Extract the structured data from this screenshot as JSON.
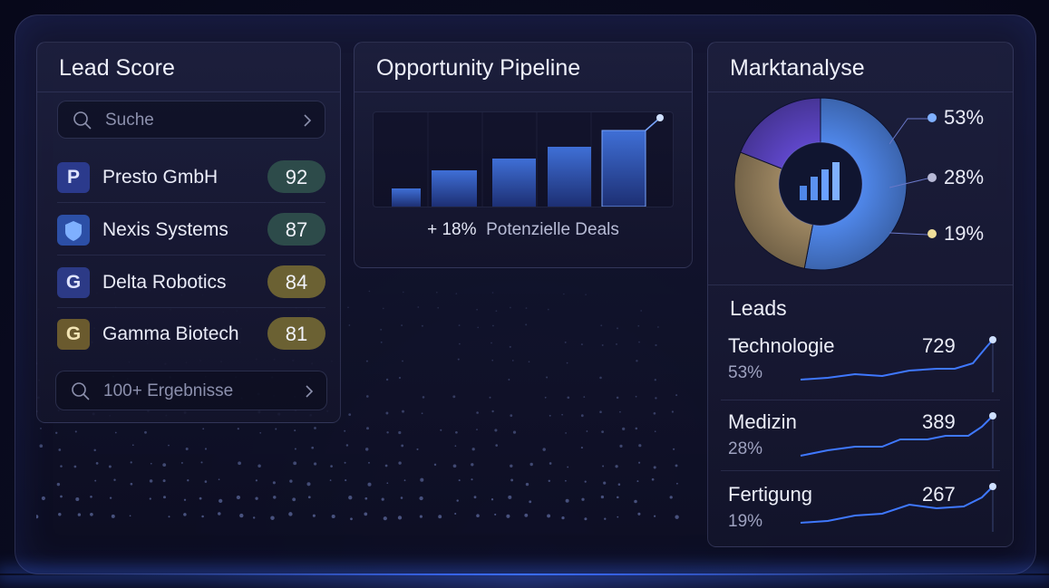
{
  "lead_score": {
    "title": "Lead Score",
    "search_placeholder": "Suche",
    "items": [
      {
        "logo": "P",
        "name": "Presto GmbH",
        "score": "92"
      },
      {
        "logo": "",
        "name": "Nexis Systems",
        "score": "87"
      },
      {
        "logo": "G",
        "name": "Delta Robotics",
        "score": "84"
      },
      {
        "logo": "G",
        "name": "Gamma Biotech",
        "score": "81"
      }
    ],
    "results_label": "100+ Ergebnisse"
  },
  "pipeline": {
    "title": "Opportunity Pipeline",
    "change": "+  18%",
    "caption": "Potenzielle Deals"
  },
  "market": {
    "title": "Marktanalyse",
    "pie": [
      {
        "label": "53%",
        "value": 53,
        "color": "#4f86e8"
      },
      {
        "label": "28%",
        "value": 28,
        "color": "#9a8460"
      },
      {
        "label": "19%",
        "value": 19,
        "color": "#5e46c8"
      }
    ],
    "leads_title": "Leads",
    "leads": [
      {
        "name": "Technologie",
        "percent": "53%",
        "value": "729"
      },
      {
        "name": "Medizin",
        "percent": "28%",
        "value": "389"
      },
      {
        "name": "Fertigung",
        "percent": "19%",
        "value": "267"
      }
    ]
  },
  "colors": {
    "accent": "#4a7cff",
    "score_green": "#2e4d4b",
    "score_gold": "#6e6334"
  },
  "icons": [
    "search-icon",
    "chevron-right-icon",
    "shield-icon",
    "bar-chart-icon"
  ]
}
